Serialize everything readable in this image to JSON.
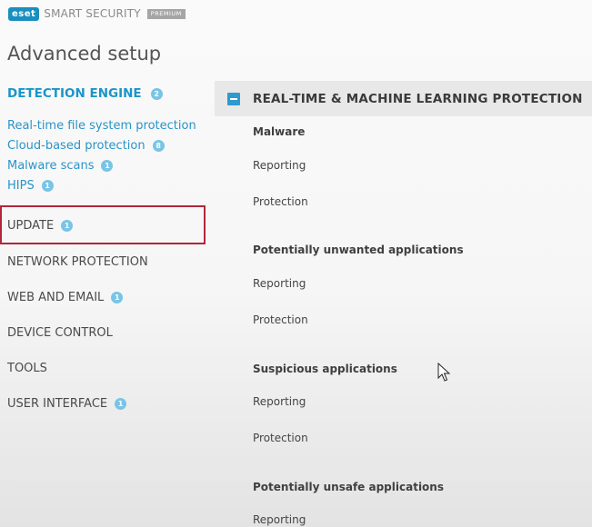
{
  "header": {
    "logo": "eset",
    "product": "SMART SECURITY",
    "tier": "PREMIUM",
    "title": "Advanced setup"
  },
  "sidebar": {
    "active": {
      "label": "DETECTION ENGINE",
      "badge": "2"
    },
    "subitems": [
      {
        "label": "Real-time file system protection",
        "badge": ""
      },
      {
        "label": "Cloud-based protection",
        "badge": "8"
      },
      {
        "label": "Malware scans",
        "badge": "1"
      },
      {
        "label": "HIPS",
        "badge": "1"
      }
    ],
    "items": [
      {
        "label": "UPDATE",
        "badge": "1"
      },
      {
        "label": "NETWORK PROTECTION",
        "badge": ""
      },
      {
        "label": "WEB AND EMAIL",
        "badge": "1"
      },
      {
        "label": "DEVICE CONTROL",
        "badge": ""
      },
      {
        "label": "TOOLS",
        "badge": ""
      },
      {
        "label": "USER INTERFACE",
        "badge": "1"
      }
    ]
  },
  "main": {
    "section_title": "REAL-TIME & MACHINE LEARNING PROTECTION",
    "groups": [
      {
        "heading": "Malware",
        "settings": [
          "Reporting",
          "Protection"
        ]
      },
      {
        "heading": "Potentially unwanted applications",
        "settings": [
          "Reporting",
          "Protection"
        ]
      },
      {
        "heading": "Suspicious applications",
        "settings": [
          "Reporting",
          "Protection"
        ]
      },
      {
        "heading": "Potentially unsafe applications",
        "settings": [
          "Reporting"
        ]
      }
    ]
  },
  "colors": {
    "accent": "#1b95c9",
    "badge": "#79c4e6",
    "highlight": "#b0273a",
    "section_bar": "#e8e8e8"
  }
}
